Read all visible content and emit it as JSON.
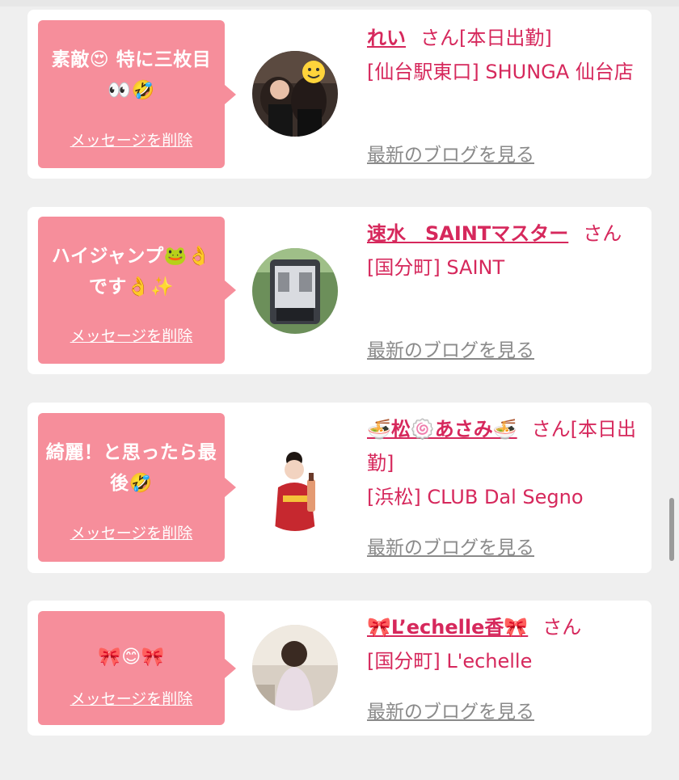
{
  "messages": [
    {
      "message": "素敵😍 特に三枚目👀🤣",
      "delete_label": "メッセージを削除",
      "name": "れい",
      "honorific": "さん",
      "status": "[本日出勤]",
      "shop": "[仙台駅東口] SHUNGA 仙台店",
      "blog_label": "最新のブログを見る",
      "avatar": "photo-two-women-selfie"
    },
    {
      "message": "ハイジャンプ🐸👌です👌✨",
      "delete_label": "メッセージを削除",
      "name": "速水　SAINTマスター",
      "honorific": "さん",
      "status": "",
      "shop": "[国分町] SAINT",
      "blog_label": "最新のブログを見る",
      "avatar": "photo-van-interior"
    },
    {
      "message": "綺麗！と思ったら最後🤣",
      "delete_label": "メッセージを削除",
      "name": "🍜松🍥あさみ🍜",
      "honorific": "さん",
      "status": "[本日出勤]",
      "shop": "[浜松] CLUB Dal Segno",
      "blog_label": "最新のブログを見る",
      "avatar": "photo-woman-red-kimono"
    },
    {
      "message": "🎀😊🎀",
      "delete_label": "メッセージを削除",
      "name": "🎀L’echelle香🎀",
      "honorific": "さん",
      "status": "",
      "shop": "[国分町] L'echelle",
      "blog_label": "最新のブログを見る",
      "avatar": "photo-woman-back-view"
    }
  ],
  "colors": {
    "page_bg": "#efefef",
    "card_bg": "#ffffff",
    "bubble_bg": "#f68e9b",
    "name_color": "#d6285c",
    "blog_link_color": "#8a8a8a"
  }
}
